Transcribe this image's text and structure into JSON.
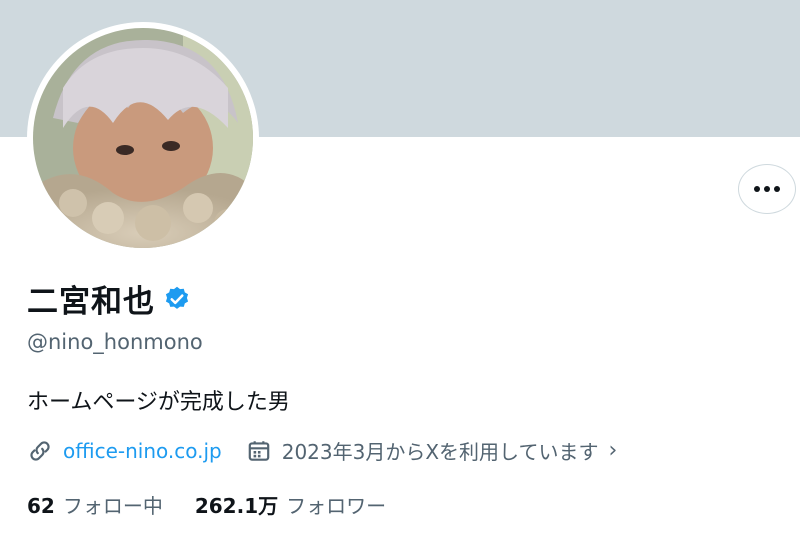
{
  "profile": {
    "display_name": "二宮和也",
    "handle": "@nino_honmono",
    "bio": "ホームページが完成した男",
    "website": "office-nino.co.jp",
    "joined": "2023年3月からXを利用しています",
    "following_count": "62",
    "following_label": "フォロー中",
    "followers_count": "262.1万",
    "followers_label": "フォロワー"
  },
  "icons": {
    "more": "more-dots-icon",
    "verified": "verified-badge-icon",
    "link": "link-icon",
    "calendar": "calendar-icon",
    "chevron": "chevron-right-icon"
  },
  "colors": {
    "banner": "#cfd9de",
    "accent": "#1d9bf0",
    "secondary_text": "#536471",
    "primary_text": "#0f1419"
  }
}
